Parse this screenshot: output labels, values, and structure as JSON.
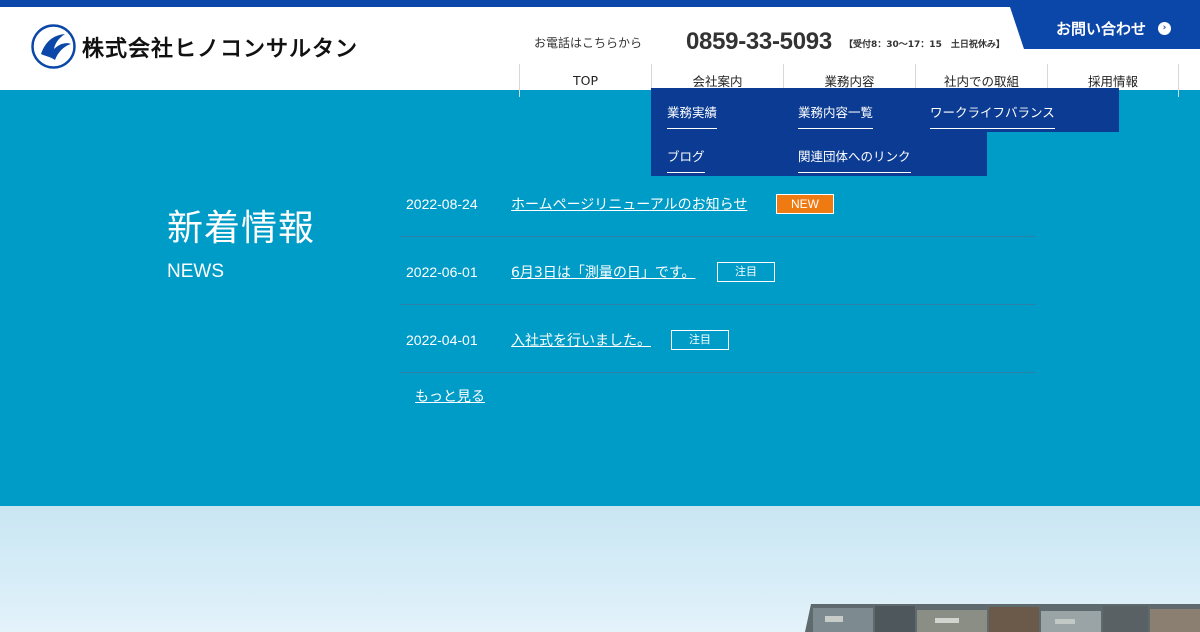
{
  "header": {
    "company_name": "株式会社ヒノコンサルタン",
    "phone_lead": "お電話はこちらから",
    "phone_number": "0859-33-5093",
    "phone_hours": "【受付8：30〜17：15　土日祝休み】",
    "contact_label": "お問い合わせ",
    "contact_arrow": "›"
  },
  "nav": {
    "items": [
      {
        "label": "TOP"
      },
      {
        "label": "会社案内"
      },
      {
        "label": "業務内容"
      },
      {
        "label": "社内での取組"
      },
      {
        "label": "採用情報"
      }
    ]
  },
  "dropdown": {
    "items": [
      {
        "label": "業務実績"
      },
      {
        "label": "業務内容一覧"
      },
      {
        "label": "ワークライフバランス"
      },
      {
        "label": "ブログ"
      },
      {
        "label": "関連団体へのリンク"
      }
    ]
  },
  "news": {
    "title": "新着情報",
    "subtitle": "NEWS",
    "items": [
      {
        "date": "2022-08-24",
        "title": "ホームページリニューアルのお知らせ",
        "badge": "NEW"
      },
      {
        "date": "2022-06-01",
        "title": "6月3日は「測量の日」です。",
        "badge": "注目"
      },
      {
        "date": "2022-04-01",
        "title": "入社式を行いました。",
        "badge": "注目"
      }
    ],
    "more_label": "もっと見る"
  },
  "colors": {
    "brand_blue": "#0b47a8",
    "section_bg": "#009cc8",
    "dropdown_bg": "#0b3b92",
    "badge_new": "#f07a12"
  }
}
